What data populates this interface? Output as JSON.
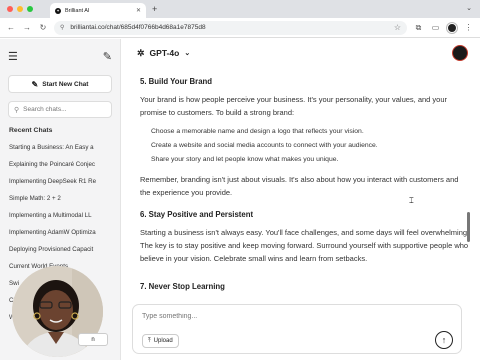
{
  "browser": {
    "tab_title": "Brilliant AI",
    "tab_favicon": "brilliant-ai-logo",
    "url": "brilliantai.co/chat/685d4f0766b4d68a1e7875d8"
  },
  "sidebar": {
    "new_chat_label": "Start New Chat",
    "search_placeholder": "Search chats...",
    "recent_heading": "Recent Chats",
    "chats": [
      "Starting a Business: An Easy a",
      "Explaining the Poincaré Conjec",
      "Implementing DeepSeek R1 Re",
      "Simple Math: 2 + 2",
      "Implementing a Multimodal LL",
      "Implementing AdamW Optimiza",
      "Deploying Provisioned Capacit",
      "Current World Events",
      "Swi",
      "Cho",
      "Wh"
    ]
  },
  "header": {
    "model_name": "GPT-4o"
  },
  "content": {
    "sec1": {
      "heading": "5. Build Your Brand",
      "intro": "Your brand is how people perceive your business. It's your personality, your values, and your promise to customers. To build a strong brand:",
      "bullets": [
        "Choose a memorable name and design a logo that reflects your vision.",
        "Create a website and social media accounts to connect with your audience.",
        "Share your story and let people know what makes you unique."
      ],
      "closing": "Remember, branding isn't just about visuals. It's also about how you interact with customers and the experience you provide."
    },
    "sec2": {
      "heading": "6. Stay Positive and Persistent",
      "body": "Starting a business isn't always easy. You'll face challenges, and some days will feel overwhelming. The key is to stay positive and keep moving forward. Surround yourself with supportive people who believe in your vision. Celebrate small wins and learn from setbacks."
    },
    "sec3": {
      "heading": "7. Never Stop Learning"
    }
  },
  "composer": {
    "placeholder": "Type something...",
    "upload_label": "Upload"
  },
  "overlay_partial": {
    "upload_ghost": "n"
  }
}
